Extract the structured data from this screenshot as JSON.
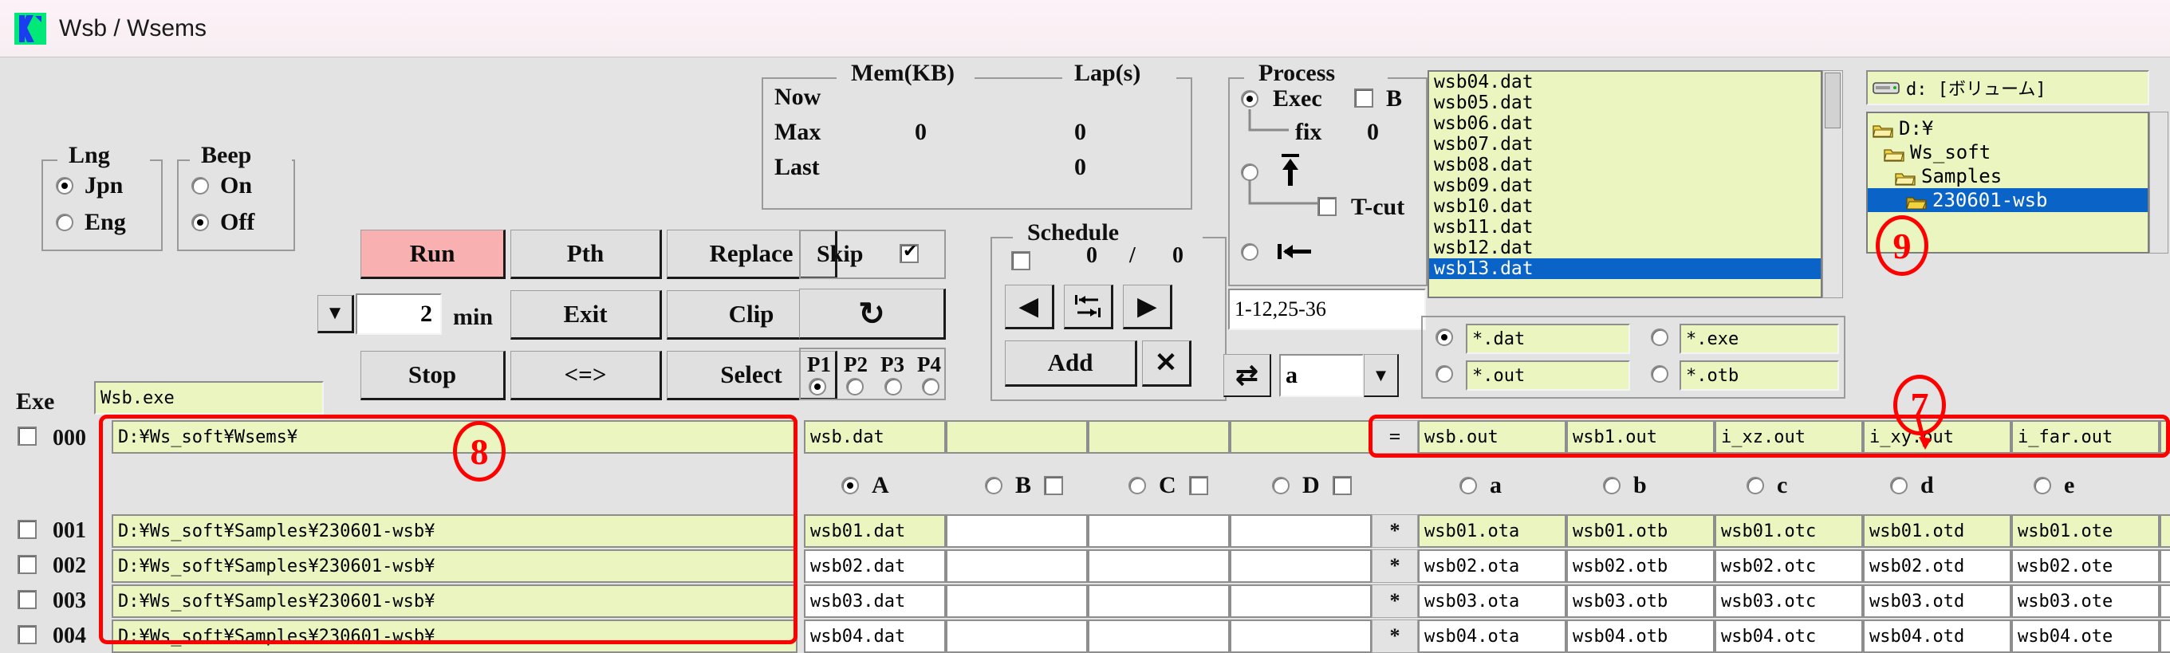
{
  "window": {
    "title": "Wsb / Wsems",
    "logo_icon": "k-logo-icon"
  },
  "lng": {
    "legend": "Lng",
    "options": [
      "Jpn",
      "Eng"
    ],
    "selected": "Jpn"
  },
  "beep": {
    "legend": "Beep",
    "options": [
      "On",
      "Off"
    ],
    "selected": "Off"
  },
  "exe": {
    "label": "Exe",
    "value": "Wsb.exe"
  },
  "buttons": {
    "run": "Run",
    "pth": "Pth",
    "replace": "Replace",
    "exit": "Exit",
    "clip": "Clip",
    "stop": "Stop",
    "swap": "<=>",
    "select": "Select",
    "refresh_icon": "↻",
    "add": "Add",
    "close_x": "✕",
    "prev_icon": "◀",
    "next_icon": "▶",
    "swap_rows_icon": "swap-rows-icon"
  },
  "timer": {
    "value": "2",
    "unit": "min",
    "dropdown_icon": "▼"
  },
  "skip": {
    "label": "Skip",
    "checked": true
  },
  "pports": {
    "labels": [
      "P1",
      "P2",
      "P3",
      "P4"
    ],
    "selected": "P1"
  },
  "mem": {
    "legend_mem": "Mem(KB)",
    "legend_lap": "Lap(s)",
    "rows": [
      {
        "label": "Now",
        "mem": "",
        "lap": ""
      },
      {
        "label": "Max",
        "mem": "0",
        "lap": "0"
      },
      {
        "label": "Last",
        "mem": "",
        "lap": "0"
      }
    ]
  },
  "schedule": {
    "legend": "Schedule",
    "checked": false,
    "current": "0",
    "separator": "/",
    "total": "0"
  },
  "process": {
    "legend": "Process",
    "exec_label": "Exec",
    "exec_selected": true,
    "b_label": "B",
    "b_checked": false,
    "fix_label": "fix",
    "fix_value": "0",
    "up_icon": "⤒",
    "up_selected": false,
    "tcut_label": "T-cut",
    "tcut_checked": false,
    "home_icon": "⇤",
    "home_selected": false,
    "range_value": "1-12,25-36"
  },
  "filelist": {
    "items": [
      "wsb04.dat",
      "wsb05.dat",
      "wsb06.dat",
      "wsb07.dat",
      "wsb08.dat",
      "wsb09.dat",
      "wsb10.dat",
      "wsb11.dat",
      "wsb12.dat",
      "wsb13.dat"
    ],
    "selected": "wsb13.dat"
  },
  "filters": {
    "options": [
      "*.dat",
      "*.exe",
      "*.out",
      "*.otb"
    ],
    "selected": "*.dat"
  },
  "swapcombo": {
    "swap_icon": "⇄",
    "value": "a",
    "dropdown_icon": "▼"
  },
  "drive": {
    "icon": "drive-icon",
    "label": "d: [ボリューム]"
  },
  "tree": {
    "items": [
      {
        "label": "D:¥",
        "indent": 0,
        "selected": false
      },
      {
        "label": "Ws_soft",
        "indent": 1,
        "selected": false
      },
      {
        "label": "Samples",
        "indent": 2,
        "selected": false
      },
      {
        "label": "230601-wsb",
        "indent": 3,
        "selected": true
      }
    ]
  },
  "table": {
    "mode_upper": {
      "options": [
        "A",
        "B",
        "C",
        "D"
      ],
      "selected": "A",
      "checkboxes": {
        "B": false,
        "C": false,
        "D": false
      }
    },
    "mode_lower": {
      "options": [
        "a",
        "b",
        "c",
        "d",
        "e"
      ],
      "selected": ""
    },
    "header_row": {
      "index": "000",
      "checked": false,
      "path": "D:¥Ws_soft¥Wsems¥",
      "input": "wsb.dat",
      "eq": "=",
      "outputs": [
        "wsb.out",
        "wsb1.out",
        "i_xz.out",
        "i_xy.out",
        "i_far.out"
      ]
    },
    "rows": [
      {
        "index": "001",
        "checked": false,
        "path": "D:¥Ws_soft¥Samples¥230601-wsb¥",
        "input": "wsb01.dat",
        "star": "*",
        "outputs": [
          "wsb01.ota",
          "wsb01.otb",
          "wsb01.otc",
          "wsb01.otd",
          "wsb01.ote"
        ],
        "highlight": true
      },
      {
        "index": "002",
        "checked": false,
        "path": "D:¥Ws_soft¥Samples¥230601-wsb¥",
        "input": "wsb02.dat",
        "star": "*",
        "outputs": [
          "wsb02.ota",
          "wsb02.otb",
          "wsb02.otc",
          "wsb02.otd",
          "wsb02.ote"
        ],
        "highlight": false
      },
      {
        "index": "003",
        "checked": false,
        "path": "D:¥Ws_soft¥Samples¥230601-wsb¥",
        "input": "wsb03.dat",
        "star": "*",
        "outputs": [
          "wsb03.ota",
          "wsb03.otb",
          "wsb03.otc",
          "wsb03.otd",
          "wsb03.ote"
        ],
        "highlight": false
      },
      {
        "index": "004",
        "checked": false,
        "path": "D:¥Ws_soft¥Samples¥230601-wsb¥",
        "input": "wsb04.dat",
        "star": "*",
        "outputs": [
          "wsb04.ota",
          "wsb04.otb",
          "wsb04.otc",
          "wsb04.otd",
          "wsb04.ote"
        ],
        "highlight": false
      }
    ]
  },
  "annotations": [
    {
      "label": "8"
    },
    {
      "label": "7"
    },
    {
      "label": "9"
    }
  ],
  "colors": {
    "accent_red": "#ff0000",
    "field_green": "#eaf5c0",
    "select_blue": "#0a64c8",
    "run_pink": "#f9b0b0",
    "window_grey": "#e3e3e3"
  }
}
